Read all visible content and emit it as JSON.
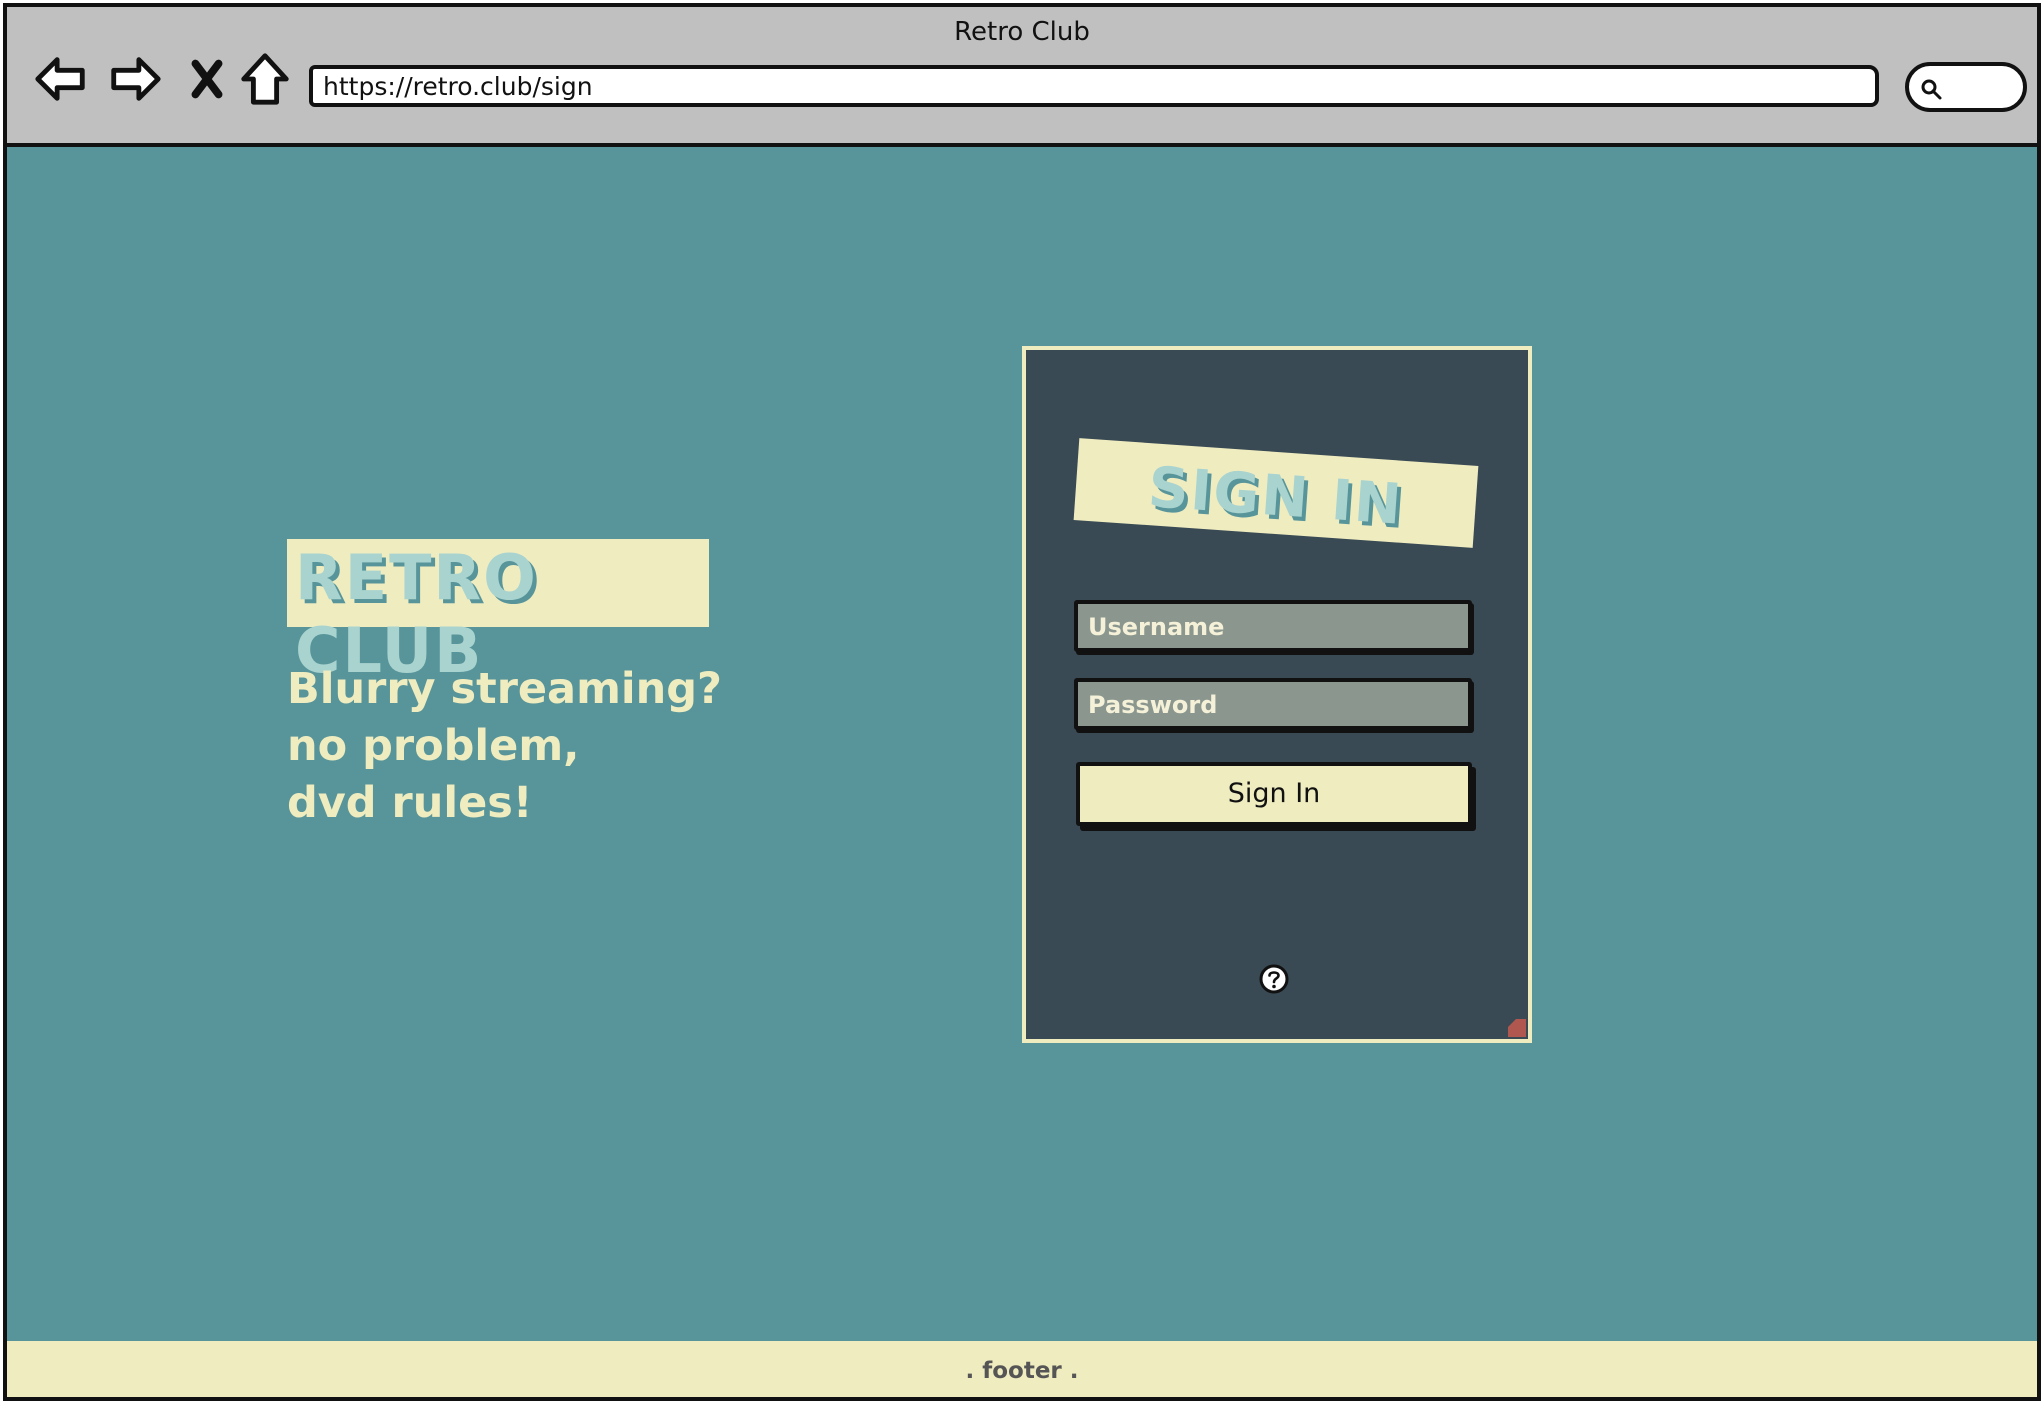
{
  "window": {
    "title": "Retro Club"
  },
  "toolbar": {
    "back_icon": "back-arrow-icon",
    "forward_icon": "forward-arrow-icon",
    "stop_icon": "close-icon",
    "home_icon": "home-icon",
    "url": "https://retro.club/sign",
    "search_icon": "search-icon"
  },
  "hero": {
    "brand": "RETRO CLUB",
    "tagline": [
      "Blurry streaming?",
      "no problem,",
      "dvd rules!"
    ]
  },
  "signin": {
    "title": "SIGN IN",
    "username_placeholder": "Username",
    "password_placeholder": "Password",
    "button_label": "Sign In",
    "help_icon": "help-icon"
  },
  "footer": {
    "text": ". footer ."
  },
  "colors": {
    "page_bg": "#58959a",
    "card_bg": "#394a54",
    "cream": "#efecc0",
    "title_mint": "#a9d3cf",
    "field_bg": "#8a968e",
    "chrome": "#c0c0c0"
  }
}
